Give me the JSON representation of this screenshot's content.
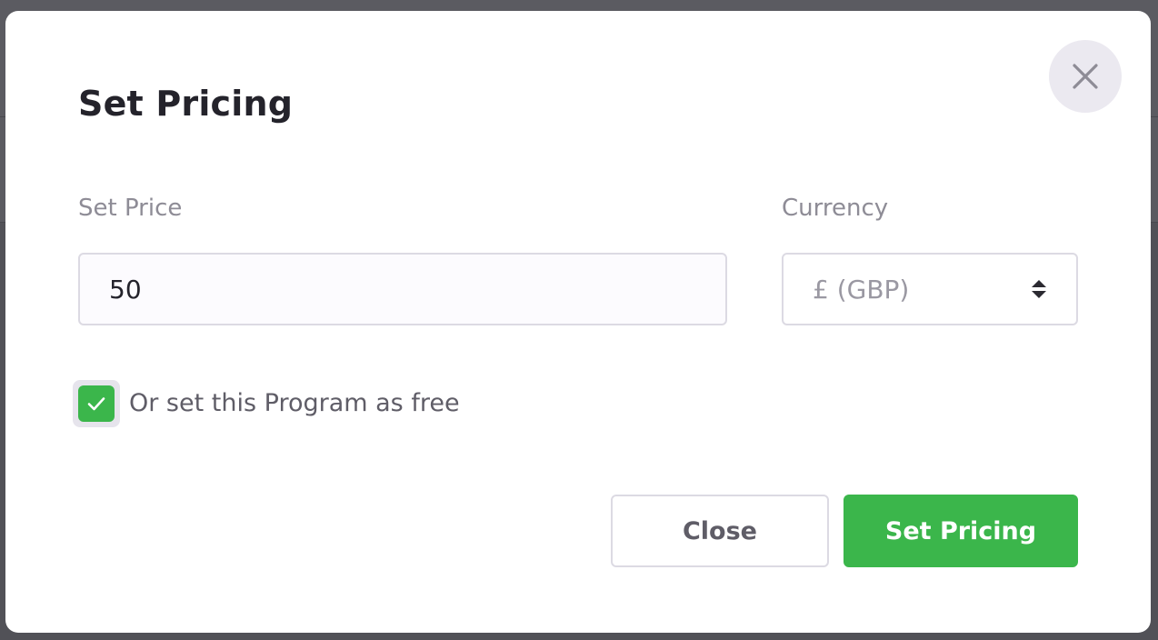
{
  "dialog": {
    "title": "Set Pricing",
    "close_icon": "close-icon"
  },
  "price": {
    "label": "Set Price",
    "value": "50"
  },
  "currency": {
    "label": "Currency",
    "selected": "£ (GBP)",
    "icon": "sort-arrows-icon"
  },
  "free_option": {
    "label": "Or set this Program as free",
    "checked": true,
    "icon": "check-icon"
  },
  "actions": {
    "close_label": "Close",
    "submit_label": "Set Pricing"
  },
  "colors": {
    "accent": "#3bb64b",
    "backdrop": "#515157",
    "title": "#24232b",
    "muted_label": "#8e8c96"
  }
}
